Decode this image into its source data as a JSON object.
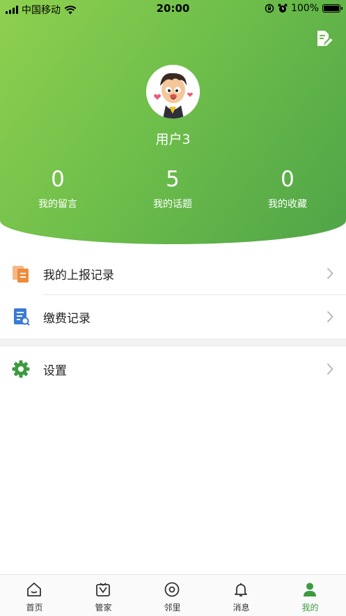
{
  "status_bar": {
    "carrier": "中国移动",
    "time": "20:00",
    "battery": "100%"
  },
  "profile": {
    "username": "用户3",
    "stats": [
      {
        "value": "0",
        "label": "我的留言"
      },
      {
        "value": "5",
        "label": "我的话题"
      },
      {
        "value": "0",
        "label": "我的收藏"
      }
    ]
  },
  "menu": {
    "items": [
      {
        "label": "我的上报记录",
        "icon": "report-document-icon",
        "icon_color": "#f08a3c"
      },
      {
        "label": "缴费记录",
        "icon": "payment-record-icon",
        "icon_color": "#3a7bd5"
      },
      {
        "label": "设置",
        "icon": "gear-icon",
        "icon_color": "#3d9a3f"
      }
    ]
  },
  "tabbar": {
    "tabs": [
      {
        "label": "首页",
        "icon": "home-icon"
      },
      {
        "label": "管家",
        "icon": "butler-icon"
      },
      {
        "label": "邻里",
        "icon": "neighbor-icon"
      },
      {
        "label": "消息",
        "icon": "bell-icon"
      },
      {
        "label": "我的",
        "icon": "user-icon",
        "active": true
      }
    ]
  },
  "colors": {
    "accent": "#3d9a3f",
    "header_gradient_start": "#8fd04f",
    "header_gradient_end": "#4fa447"
  }
}
